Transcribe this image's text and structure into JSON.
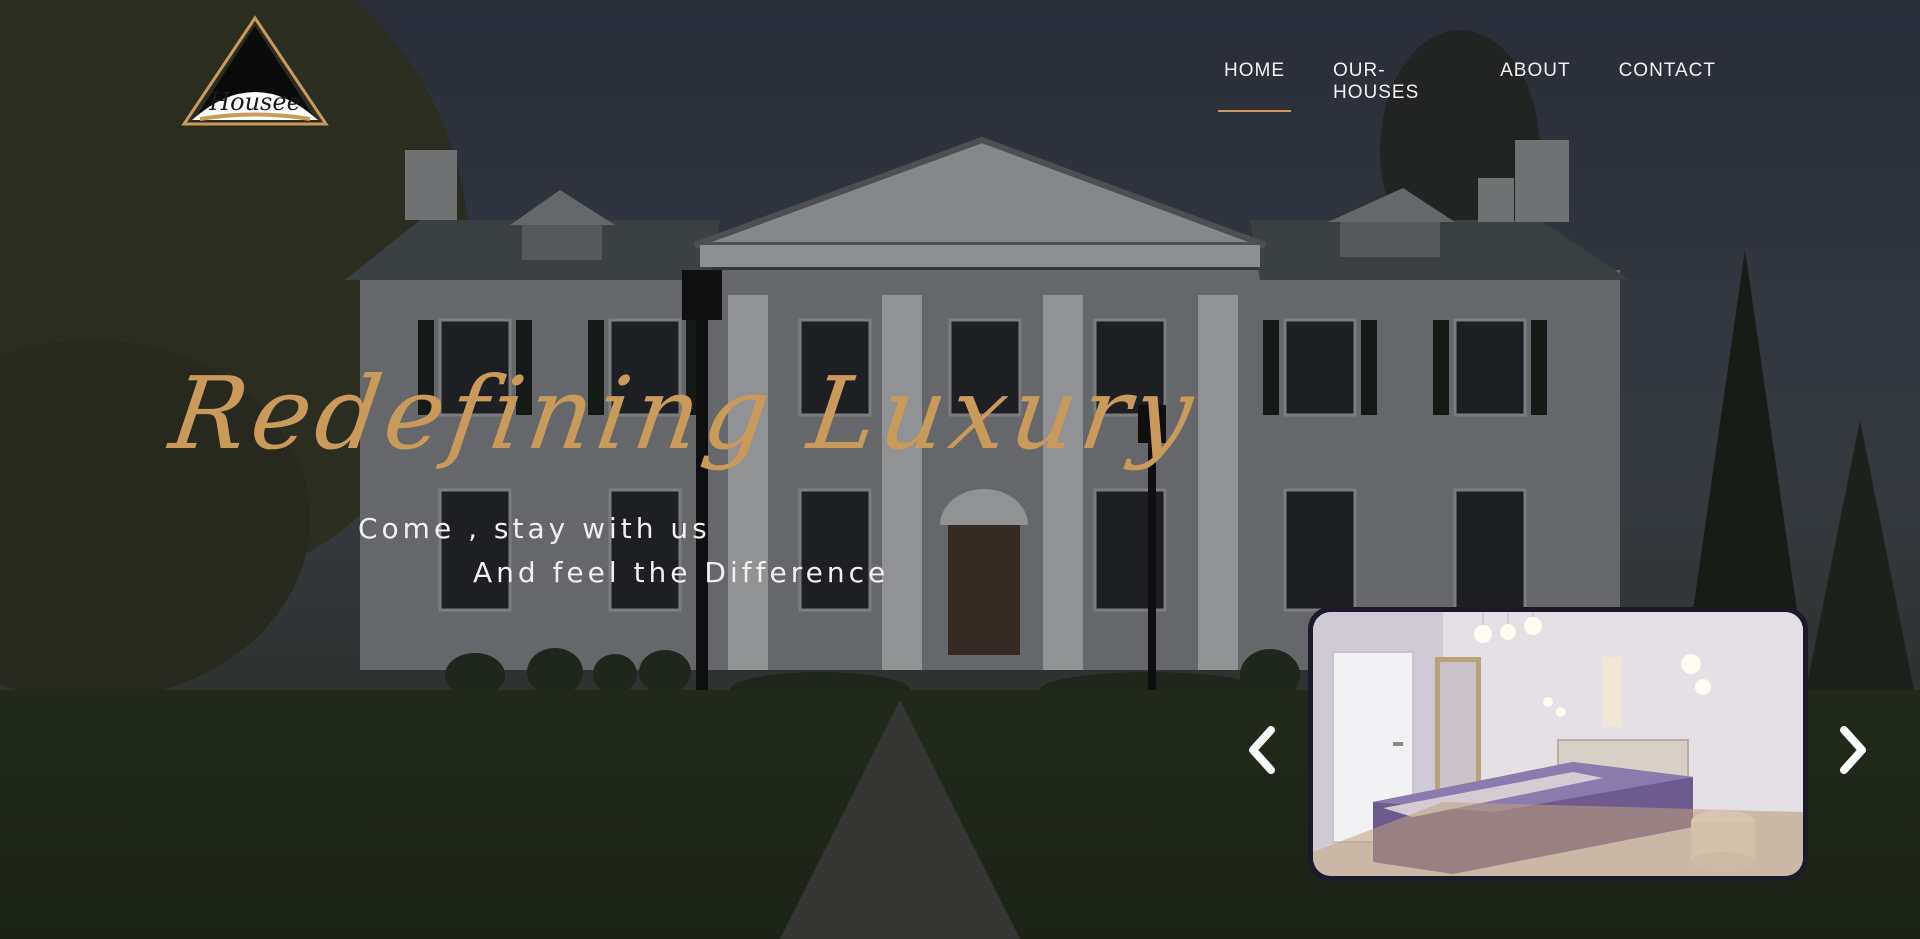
{
  "brand": {
    "logo_text": "Housee"
  },
  "nav": {
    "items": [
      {
        "label": "HOME",
        "active": true
      },
      {
        "label": "OUR-HOUSES",
        "active": false
      },
      {
        "label": "ABOUT",
        "active": false
      },
      {
        "label": "CONTACT",
        "active": false
      }
    ]
  },
  "hero": {
    "title": "Redefining Luxury",
    "line1": "Come , stay with us",
    "line2": "And feel the Difference"
  },
  "carousel": {
    "prev_icon": "chevron-left-icon",
    "next_icon": "chevron-right-icon",
    "slide_subject": "bedroom"
  },
  "colors": {
    "accent": "#c99a5a",
    "text": "#f2f2f2"
  }
}
